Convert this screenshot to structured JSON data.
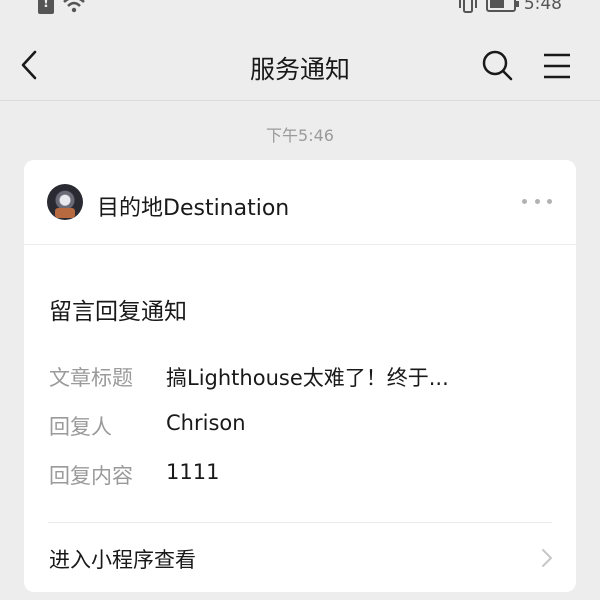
{
  "status_bar": {
    "time": "5:48",
    "icons": [
      "sim-alert-icon",
      "wifi-icon",
      "vibrate-icon",
      "battery-icon"
    ]
  },
  "nav": {
    "title": "服务通知",
    "back_icon": "chevron-left-icon",
    "search_icon": "search-icon",
    "menu_icon": "menu-icon"
  },
  "timestamp": "下午5:46",
  "card": {
    "account_name": "目的地Destination",
    "more_icon": "more-dots-icon",
    "notice_title": "留言回复通知",
    "fields": [
      {
        "label": "文章标题",
        "value": "搞Lighthouse太难了！终于..."
      },
      {
        "label": "回复人",
        "value": "Chrison"
      },
      {
        "label": "回复内容",
        "value": "1111"
      }
    ],
    "link_label": "进入小程序查看",
    "link_icon": "chevron-right-icon"
  },
  "colors": {
    "background": "#ededed",
    "card": "#ffffff",
    "label_gray": "#9a9a9a",
    "text": "#191919"
  }
}
